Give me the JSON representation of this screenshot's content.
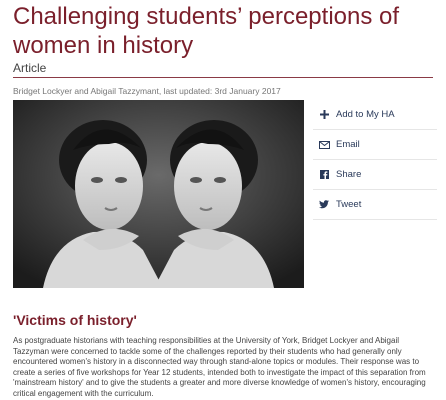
{
  "article": {
    "title": "Challenging students’ perceptions of women in history",
    "type": "Article",
    "byline": "Bridget Lockyer and Abigail Tazzymant, last updated: 3rd January 2017"
  },
  "share": {
    "items": [
      {
        "label": "Add to My HA",
        "icon": "plus-icon"
      },
      {
        "label": "Email",
        "icon": "envelope-icon"
      },
      {
        "label": "Share",
        "icon": "facebook-icon"
      },
      {
        "label": "Tweet",
        "icon": "twitter-icon"
      }
    ]
  },
  "section": {
    "heading": "'Victims of history'",
    "paragraph": "As postgraduate historians with teaching responsibilities at the University of York, Bridget Lockyer and Abigail Tazzyman were concerned to tackle some of the challenges reported by their students who had generally only encountered women's history in a disconnected way through stand-alone topics or modules. Their response was to create a series of five workshops for Year 12 students, intended both to investigate the impact of this separation from 'mainstream history' and to give the students a greater and more diverse knowledge of women's history, encouraging critical engagement with the curriculum."
  },
  "colors": {
    "accent": "#7a1f2b",
    "link": "#2a3a5a"
  }
}
